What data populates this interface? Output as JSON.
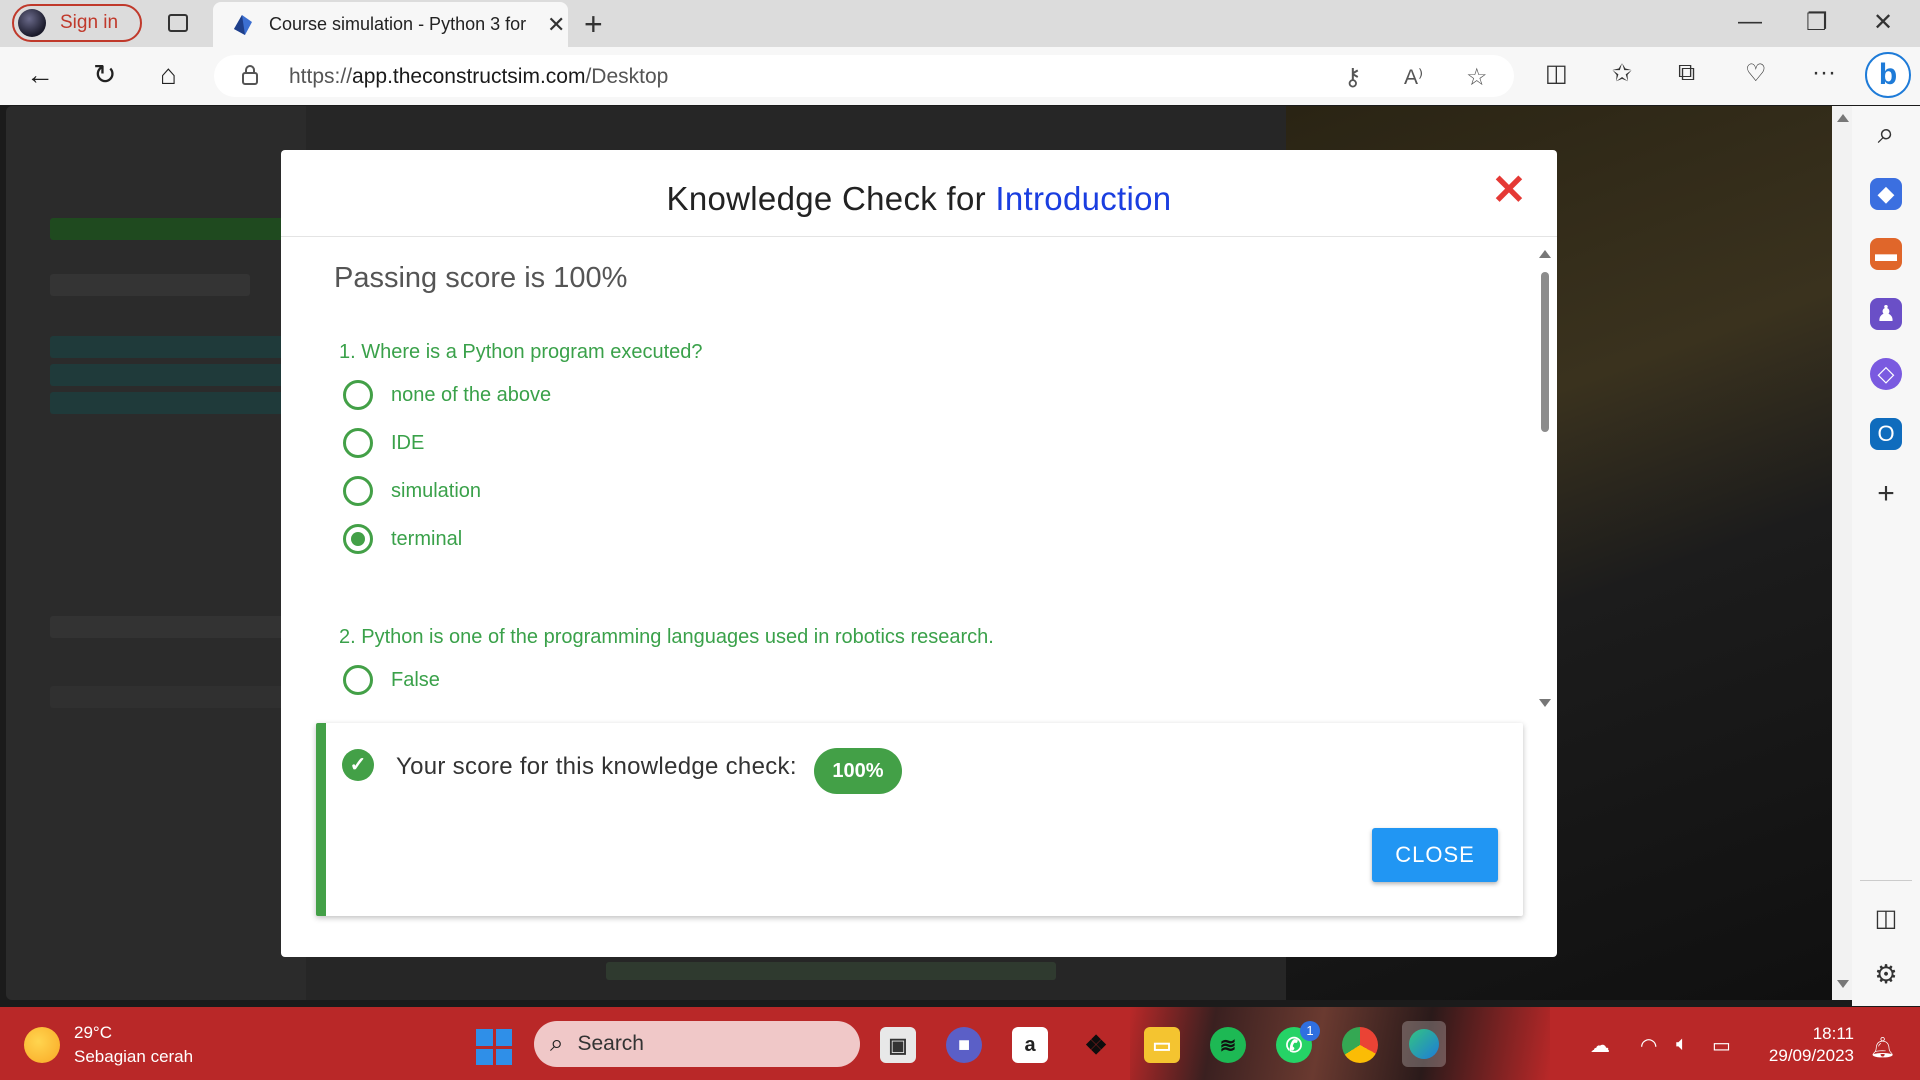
{
  "browser": {
    "signin_label": "Sign in",
    "tab_title": "Course simulation - Python 3 for",
    "url_prefix": "https://",
    "url_domain": "app.theconstructsim.com",
    "url_path": "/Desktop"
  },
  "modal": {
    "title_prefix": "Knowledge Check for ",
    "title_topic": "Introduction",
    "passing_score": "Passing score is 100%",
    "questions": [
      {
        "text": "1. Where is a Python program executed?",
        "options": [
          {
            "label": "none of the above",
            "selected": false
          },
          {
            "label": "IDE",
            "selected": false
          },
          {
            "label": "simulation",
            "selected": false
          },
          {
            "label": "terminal",
            "selected": true
          }
        ]
      },
      {
        "text": "2. Python is one of the programming languages used in robotics research.",
        "options": [
          {
            "label": "False",
            "selected": false
          }
        ]
      }
    ],
    "score_text": "Your score for this knowledge check:",
    "score_value": "100%",
    "close_label": "CLOSE"
  },
  "taskbar": {
    "temperature": "29°C",
    "weather_desc": "Sebagian cerah",
    "search_placeholder": "Search",
    "whatsapp_badge": "1",
    "time": "18:11",
    "date": "29/09/2023"
  },
  "colors": {
    "accent_green": "#43a047",
    "title_blue": "#1a3ee0",
    "close_red": "#e53935",
    "button_blue": "#2196f3",
    "taskbar_red": "#b92828"
  }
}
